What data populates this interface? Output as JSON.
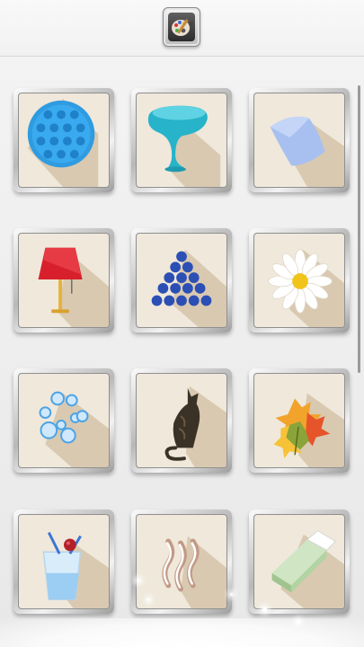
{
  "header": {
    "palette_button": {
      "icon": "palette-brush-icon"
    }
  },
  "grid": {
    "tiles": [
      {
        "subject": "pop-it"
      },
      {
        "subject": "glass"
      },
      {
        "subject": "pillow"
      },
      {
        "subject": "lamp"
      },
      {
        "subject": "balls"
      },
      {
        "subject": "daisy"
      },
      {
        "subject": "bubbles"
      },
      {
        "subject": "cat"
      },
      {
        "subject": "leaves"
      },
      {
        "subject": "drink"
      },
      {
        "subject": "steam"
      },
      {
        "subject": "eraser"
      }
    ]
  },
  "colors": {
    "tile_background": "#efe8db",
    "tile_shadow": "#d9c9b1",
    "page_background": "#ececec"
  }
}
